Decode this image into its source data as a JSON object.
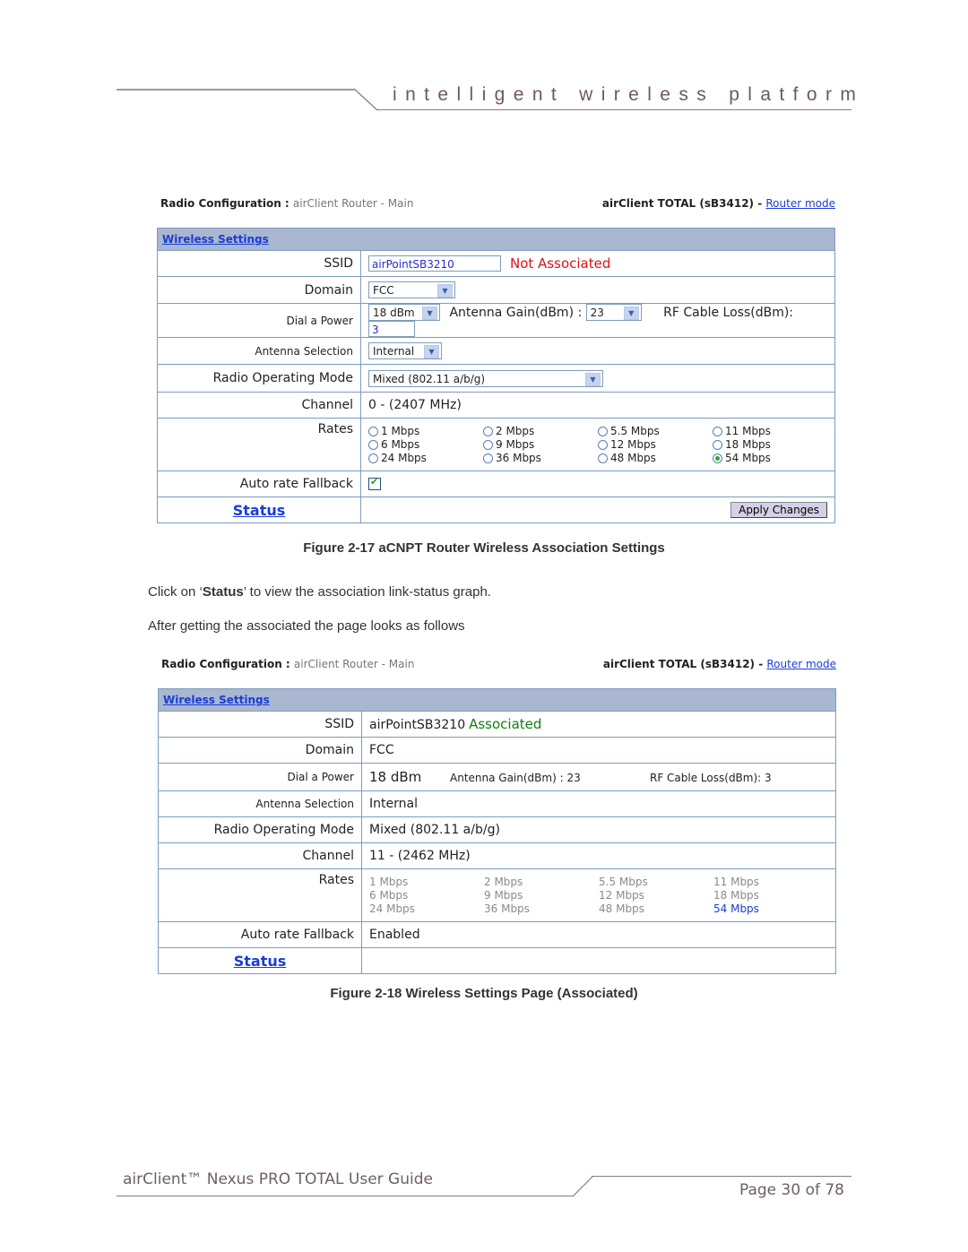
{
  "header": {
    "words": [
      "intelligent",
      "wireless",
      "platform"
    ]
  },
  "figure1": {
    "topbar": {
      "section": "Radio Configuration",
      "sep": " : ",
      "page": "airClient Router - Main",
      "device": "airClient TOTAL (sB3412) - ",
      "mode_link": "Router mode"
    },
    "table_title": "Wireless Settings",
    "ssid_label": "SSID",
    "ssid_value": "airPointSB3210",
    "ssid_status": "Not Associated",
    "domain_label": "Domain",
    "domain_value": "FCC",
    "power_label": "Dial a Power",
    "power_value": "18 dBm",
    "gain_label": "Antenna Gain(dBm) :",
    "gain_value": "23",
    "loss_label": "RF Cable Loss(dBm):",
    "loss_value": "3",
    "antenna_label": "Antenna Selection",
    "antenna_value": "Internal",
    "mode_label": "Radio Operating Mode",
    "mode_value": "Mixed (802.11 a/b/g)",
    "channel_label": "Channel",
    "channel_value": "0 - (2407 MHz)",
    "rates_label": "Rates",
    "rates": [
      "1 Mbps",
      "2 Mbps",
      "5.5 Mbps",
      "11 Mbps",
      "6 Mbps",
      "9 Mbps",
      "12 Mbps",
      "18 Mbps",
      "24 Mbps",
      "36 Mbps",
      "48 Mbps",
      "54 Mbps"
    ],
    "selected_rate": "54 Mbps",
    "fallback_label": "Auto rate Fallback",
    "fallback_checked": true,
    "status_link": "Status",
    "apply_button": "Apply Changes"
  },
  "caption1": "Figure 2-17 aCNPT Router Wireless Association Settings",
  "para1": {
    "before": "Click on ‘",
    "bold": "Status",
    "after": "’ to view the association link-status graph."
  },
  "para2": "After getting the associated the page looks as follows",
  "figure2": {
    "topbar": {
      "section": "Radio Configuration",
      "sep": " : ",
      "page": "airClient Router - Main",
      "device": "airClient TOTAL (sB3412) - ",
      "mode_link": "Router mode"
    },
    "table_title": "Wireless Settings",
    "ssid_label": "SSID",
    "ssid_value": "airPointSB3210",
    "ssid_status": "Associated",
    "domain_label": "Domain",
    "domain_value": "FCC",
    "power_label": "Dial a Power",
    "power_value": "18 dBm",
    "gain_text": "Antenna Gain(dBm) : 23",
    "loss_text": "RF Cable Loss(dBm): 3",
    "antenna_label": "Antenna Selection",
    "antenna_value": "Internal",
    "mode_label": "Radio Operating Mode",
    "mode_value": "Mixed (802.11 a/b/g)",
    "channel_label": "Channel",
    "channel_value": "11 - (2462 MHz)",
    "rates_label": "Rates",
    "rates": [
      "1 Mbps",
      "2 Mbps",
      "5.5 Mbps",
      "11 Mbps",
      "6 Mbps",
      "9 Mbps",
      "12 Mbps",
      "18 Mbps",
      "24 Mbps",
      "36 Mbps",
      "48 Mbps",
      "54 Mbps"
    ],
    "selected_rate": "54 Mbps",
    "fallback_label": "Auto rate Fallback",
    "fallback_value": "Enabled",
    "status_link": "Status"
  },
  "caption2": "Figure 2-18 Wireless Settings Page (Associated)",
  "footer": {
    "title": "airClient™ Nexus PRO TOTAL User Guide",
    "page": "Page 30 of 78"
  },
  "colors": {
    "link": "#1a3cd8",
    "not_associated": "#e01010",
    "associated": "#108010",
    "table_header_bg": "#a9b7d1",
    "table_border": "#7f9bbd"
  }
}
